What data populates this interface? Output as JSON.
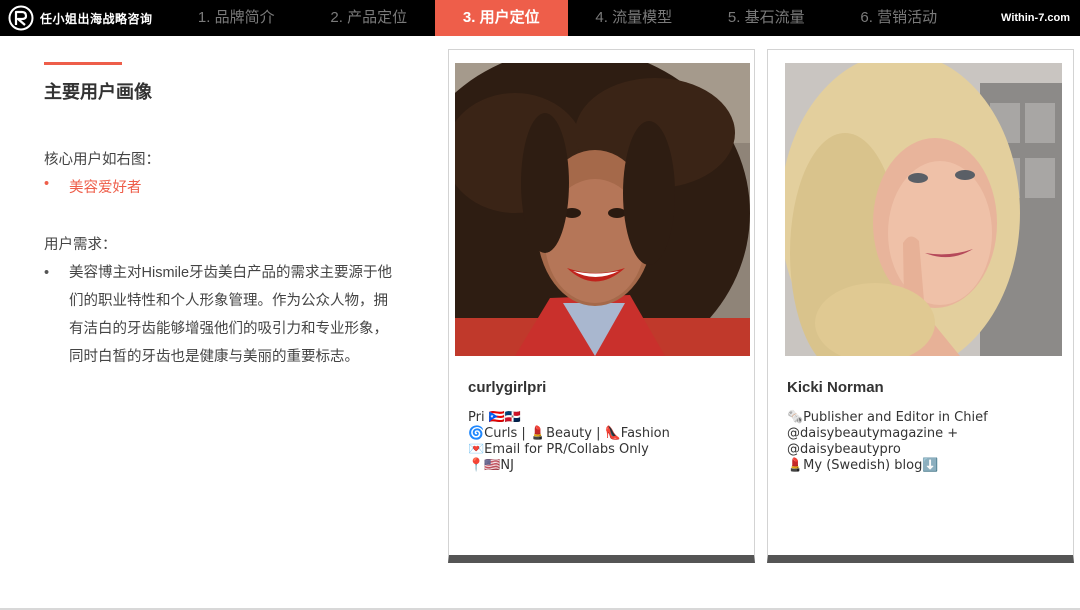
{
  "header": {
    "logo_text": "任小姐出海战略咨询",
    "brand": "Within-7.com",
    "tabs": [
      {
        "label": "1. 品牌简介"
      },
      {
        "label": "2. 产品定位"
      },
      {
        "label": "3. 用户定位"
      },
      {
        "label": "4. 流量模型"
      },
      {
        "label": "5. 基石流量"
      },
      {
        "label": "6. 营销活动"
      }
    ],
    "active_tab_index": 2
  },
  "main": {
    "title": "主要用户画像",
    "core_label": "核心用户如右图：",
    "core_item": "美容爱好者",
    "needs_label": "用户需求：",
    "needs_item": "美容博主对Hismile牙齿美白产品的需求主要源于他们的职业特性和个人形象管理。作为公众人物，拥有洁白的牙齿能够增强他们的吸引力和专业形象，同时白皙的牙齿也是健康与美丽的重要标志。",
    "bullet": "•"
  },
  "cards": [
    {
      "handle": "curlygirlpri",
      "bio": "Pri 🇵🇷🇩🇴\n🌀Curls | 💄Beauty | 👠Fashion\n💌Email for PR/Collabs Only\n📍🇺🇸NJ"
    },
    {
      "handle": "Kicki Norman",
      "bio": "🗞️Publisher and Editor in Chief\n@daisybeautymagazine +\n@daisybeautypro\n💄My (Swedish) blog⬇️"
    }
  ],
  "colors": {
    "accent": "#ee5e4a",
    "header_bg": "#000000",
    "card_bottom": "#555555"
  }
}
